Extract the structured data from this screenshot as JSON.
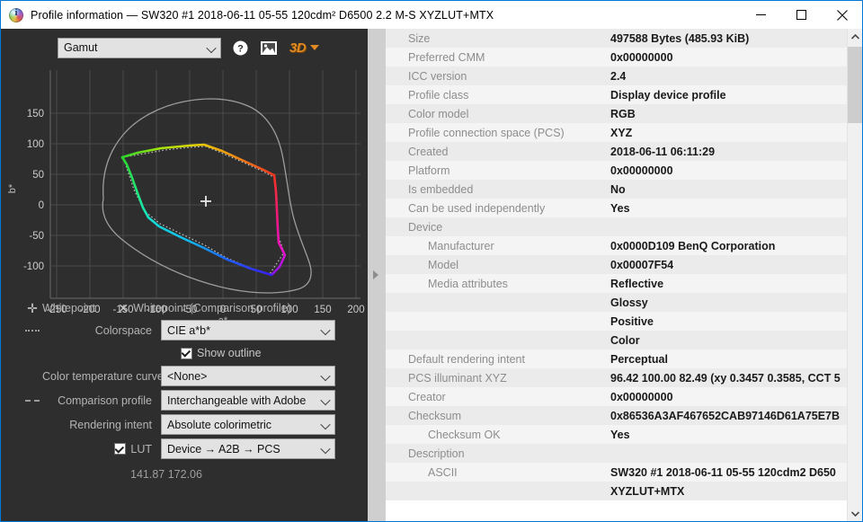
{
  "window": {
    "title": "Profile information — SW320 #1 2018-06-11 05-55 120cdm² D6500 2.2 M-S XYZLUT+MTX",
    "icon": "info-icon",
    "minimize_label": "Minimize",
    "maximize_label": "Maximize",
    "close_label": "Close"
  },
  "toolbar": {
    "view_selected": "Gamut",
    "view_options": [
      "Gamut"
    ],
    "help_icon": "question-mark-icon",
    "image_icon": "picture-icon",
    "three_d_label": "3D"
  },
  "plot": {
    "xlabel": "a*",
    "ylabel": "b*",
    "xticks": [
      -250,
      -200,
      -150,
      -100,
      -50,
      0,
      50,
      100,
      150,
      200
    ],
    "yticks": [
      150,
      100,
      50,
      0,
      -50,
      -100
    ],
    "coords_readout": "141.87 172.06"
  },
  "chart_data": {
    "type": "scatter",
    "title": "",
    "xlabel": "a*",
    "ylabel": "b*",
    "xlim": [
      -275,
      215
    ],
    "ylim": [
      -140,
      165
    ],
    "grid": true,
    "legend_position": "below-plot",
    "series": [
      {
        "name": "Whitepoint",
        "marker": "plus",
        "color": "#e6e6e6",
        "points": [
          [
            0,
            0
          ]
        ]
      },
      {
        "name": "Colorspace",
        "style": "gamut-outline-colored",
        "points": [
          [
            -152,
            82
          ],
          [
            -142,
            87
          ],
          [
            -120,
            91
          ],
          [
            -95,
            94
          ],
          [
            -60,
            96
          ],
          [
            -35,
            98
          ],
          [
            -8,
            88
          ],
          [
            25,
            72
          ],
          [
            55,
            57
          ],
          [
            76,
            46
          ],
          [
            80,
            20
          ],
          [
            82,
            -10
          ],
          [
            84,
            -40
          ],
          [
            86,
            -62
          ],
          [
            96,
            -82
          ],
          [
            72,
            -112
          ],
          [
            45,
            -104
          ],
          [
            10,
            -88
          ],
          [
            -22,
            -70
          ],
          [
            -55,
            -52
          ],
          [
            -88,
            -36
          ],
          [
            -108,
            -18
          ],
          [
            -125,
            8
          ],
          [
            -140,
            40
          ],
          [
            -152,
            82
          ]
        ]
      },
      {
        "name": "Comparison profile",
        "style": "dotted",
        "color": "#b9b9b9",
        "points": [
          [
            -150,
            80
          ],
          [
            -130,
            86
          ],
          [
            -100,
            92
          ],
          [
            -60,
            95
          ],
          [
            -35,
            96
          ],
          [
            -5,
            86
          ],
          [
            30,
            69
          ],
          [
            60,
            54
          ],
          [
            78,
            44
          ],
          [
            80,
            10
          ],
          [
            82,
            -25
          ],
          [
            84,
            -55
          ],
          [
            92,
            -80
          ],
          [
            70,
            -110
          ],
          [
            40,
            -100
          ],
          [
            5,
            -84
          ],
          [
            -28,
            -66
          ],
          [
            -62,
            -48
          ],
          [
            -95,
            -32
          ],
          [
            -118,
            -10
          ],
          [
            -134,
            25
          ],
          [
            -150,
            80
          ]
        ]
      },
      {
        "name": "Spectrum locus outline",
        "style": "solid",
        "color": "#9d9d9d",
        "points": [
          [
            -180,
            18
          ],
          [
            -172,
            60
          ],
          [
            -150,
            100
          ],
          [
            -118,
            126
          ],
          [
            -80,
            138
          ],
          [
            -40,
            143
          ],
          [
            -5,
            140
          ],
          [
            30,
            120
          ],
          [
            55,
            90
          ],
          [
            68,
            50
          ],
          [
            74,
            10
          ],
          [
            80,
            -30
          ],
          [
            95,
            -62
          ],
          [
            112,
            -85
          ],
          [
            118,
            -105
          ],
          [
            100,
            -118
          ],
          [
            60,
            -124
          ],
          [
            20,
            -120
          ],
          [
            -30,
            -108
          ],
          [
            -80,
            -86
          ],
          [
            -125,
            -54
          ],
          [
            -165,
            -18
          ],
          [
            -180,
            18
          ]
        ]
      }
    ]
  },
  "legend": [
    {
      "glyph": "+",
      "label": "Whitepoint"
    },
    {
      "glyph": "×",
      "label": "Whitepoint (Comparison profile)"
    }
  ],
  "controls": {
    "colorspace": {
      "marker": "dotted-line",
      "label": "Colorspace",
      "value": "CIE a*b*",
      "options": [
        "CIE a*b*"
      ]
    },
    "show_outline": {
      "label": "Show outline",
      "checked": true
    },
    "color_temperature_curve": {
      "label": "Color temperature curve",
      "value": "<None>",
      "options": [
        "<None>"
      ]
    },
    "comparison_profile": {
      "marker": "dashed-line",
      "label": "Comparison profile",
      "value": "Interchangeable with Adobe",
      "options": [
        "Interchangeable with Adobe"
      ]
    },
    "rendering_intent": {
      "label": "Rendering intent",
      "value": "Absolute colorimetric",
      "options": [
        "Absolute colorimetric"
      ]
    },
    "lut": {
      "label": "LUT",
      "checked": true,
      "value": "Device → A2B → PCS",
      "options": [
        "Device → A2B → PCS"
      ]
    }
  },
  "info_table": {
    "rows": [
      {
        "key": "Size",
        "value": "497588 Bytes (485.93 KiB)",
        "indent": 0
      },
      {
        "key": "Preferred CMM",
        "value": "0x00000000",
        "indent": 0
      },
      {
        "key": "ICC version",
        "value": "2.4",
        "indent": 0
      },
      {
        "key": "Profile class",
        "value": "Display device profile",
        "indent": 0
      },
      {
        "key": "Color model",
        "value": "RGB",
        "indent": 0
      },
      {
        "key": "Profile connection space (PCS)",
        "value": "XYZ",
        "indent": 0
      },
      {
        "key": "Created",
        "value": "2018-06-11 06:11:29",
        "indent": 0
      },
      {
        "key": "Platform",
        "value": "0x00000000",
        "indent": 0
      },
      {
        "key": "Is embedded",
        "value": "No",
        "indent": 0
      },
      {
        "key": "Can be used independently",
        "value": "Yes",
        "indent": 0
      },
      {
        "key": "Device",
        "value": "",
        "indent": 0
      },
      {
        "key": "Manufacturer",
        "value": "0x0000D109 BenQ Corporation",
        "indent": 1
      },
      {
        "key": "Model",
        "value": "0x00007F54",
        "indent": 1
      },
      {
        "key": "Media attributes",
        "value": "Reflective",
        "indent": 1
      },
      {
        "key": "",
        "value": "Glossy",
        "indent": 1
      },
      {
        "key": "",
        "value": "Positive",
        "indent": 1
      },
      {
        "key": "",
        "value": "Color",
        "indent": 1
      },
      {
        "key": "Default rendering intent",
        "value": "Perceptual",
        "indent": 0
      },
      {
        "key": "PCS illuminant XYZ",
        "value": "96.42 100.00  82.49 (xy 0.3457 0.3585, CCT 5",
        "indent": 0
      },
      {
        "key": "Creator",
        "value": "0x00000000",
        "indent": 0
      },
      {
        "key": "Checksum",
        "value": "0x86536A3AF467652CAB97146D61A75E7B",
        "indent": 0
      },
      {
        "key": "Checksum OK",
        "value": "Yes",
        "indent": 1
      },
      {
        "key": "Description",
        "value": "",
        "indent": 0
      },
      {
        "key": "ASCII",
        "value": "SW320 #1 2018-06-11 05-55 120cdm2 D650",
        "indent": 1
      },
      {
        "key": "",
        "value": "XYZLUT+MTX",
        "indent": 1
      }
    ]
  },
  "scrollbar": {
    "up_icon": "chevron-up-icon",
    "down_icon": "chevron-down-icon"
  },
  "colors": {
    "accent": "#0078d7",
    "panel_dark": "#2e2e2e",
    "row_odd": "#ebebeb",
    "row_even": "#f4f4f4",
    "key_text": "#8d8d8d",
    "three_d_orange": "#e08a22"
  }
}
